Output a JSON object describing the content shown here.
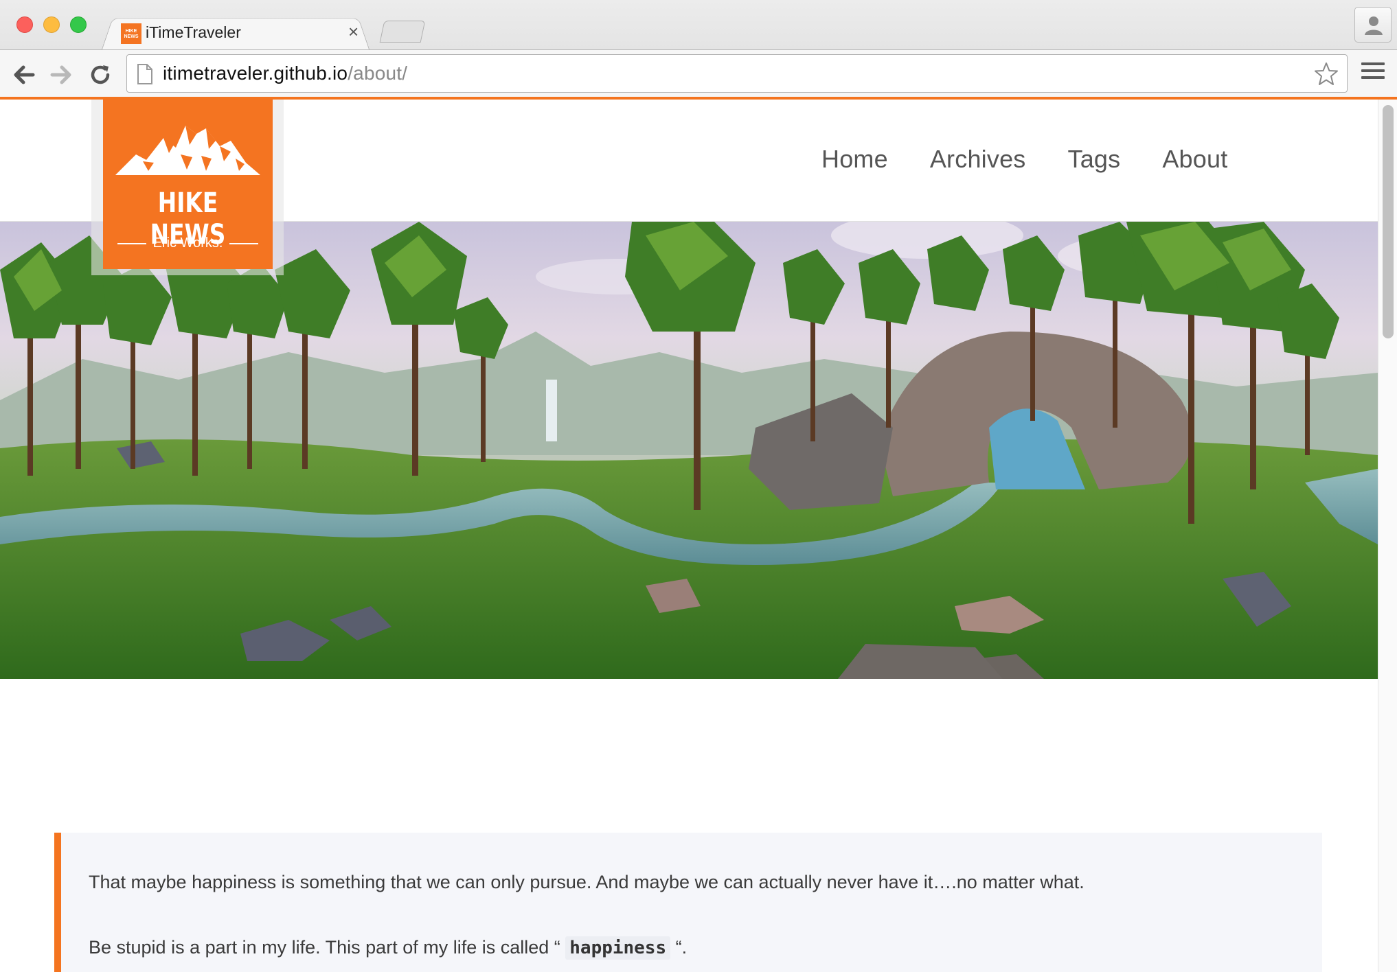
{
  "browser": {
    "tab_title": "iTimeTraveler",
    "tab_close": "×",
    "favicon_text": "HIKE NEWS",
    "url_host": "itimetraveler.github.io",
    "url_path": "/about/"
  },
  "site": {
    "logo_title": "HIKE NEWS",
    "logo_subtitle": "Eric Works.",
    "nav": [
      "Home",
      "Archives",
      "Tags",
      "About"
    ]
  },
  "colors": {
    "accent": "#f47421"
  },
  "content": {
    "quote_line_1": "That maybe happiness is something that we can only pursue. And maybe we can actually never have it….no matter what.",
    "quote_line_2_prefix": "Be stupid is a part in my life. This part of my life is called “ ",
    "quote_line_2_code": "happiness",
    "quote_line_2_suffix": " “."
  }
}
